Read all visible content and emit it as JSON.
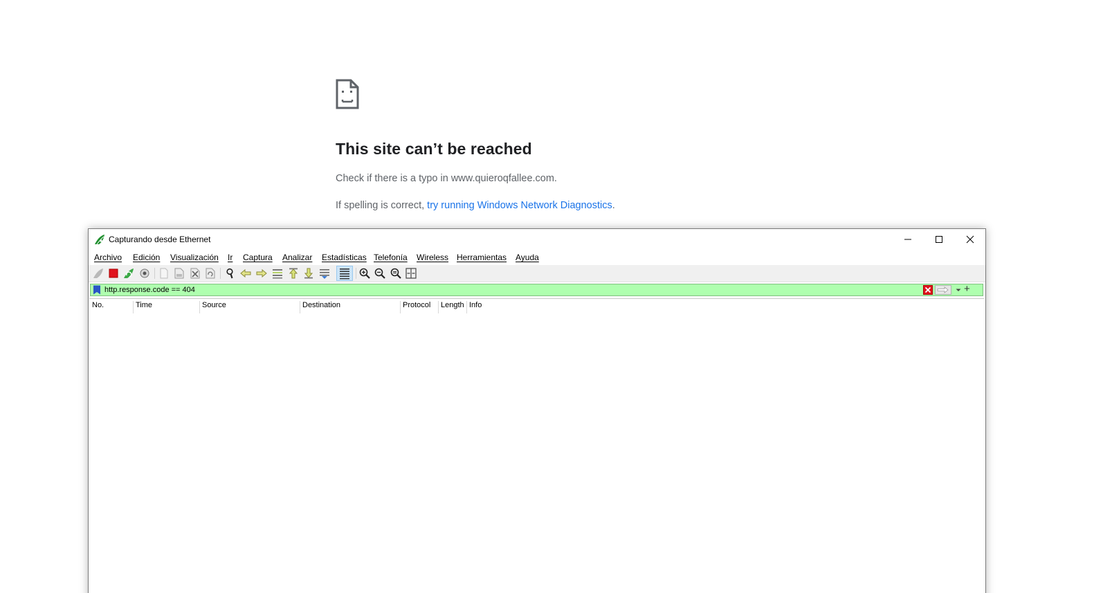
{
  "error_page": {
    "icon": "sad-document-icon",
    "title": "This site can’t be reached",
    "line1": "Check if there is a typo in www.quieroqfallee.com.",
    "line2_prefix": "If spelling is correct, ",
    "line2_link": "try running Windows Network Diagnostics",
    "line2_suffix": "."
  },
  "wireshark": {
    "title": "Capturando desde Ethernet",
    "menu": [
      "Archivo",
      "Edición",
      "Visualización",
      "Ir",
      "Captura",
      "Analizar",
      "Estadísticas",
      "Telefonía",
      "Wireless",
      "Herramientas",
      "Ayuda"
    ],
    "toolbar_icons": [
      "start-capture-icon",
      "stop-capture-icon",
      "restart-capture-icon",
      "capture-options-icon",
      "open-file-icon",
      "save-file-icon",
      "close-file-icon",
      "reload-file-icon",
      "find-packet-icon",
      "go-back-icon",
      "go-forward-icon",
      "go-to-packet-icon",
      "first-packet-icon",
      "last-packet-icon",
      "autoscroll-icon",
      "colorize-icon",
      "zoom-in-icon",
      "zoom-out-icon",
      "zoom-normal-icon",
      "resize-columns-icon"
    ],
    "filter": {
      "value": "http.response.code == 404",
      "background": "#afffaf"
    },
    "columns": [
      "No.",
      "Time",
      "Source",
      "Destination",
      "Protocol",
      "Length",
      "Info"
    ]
  }
}
